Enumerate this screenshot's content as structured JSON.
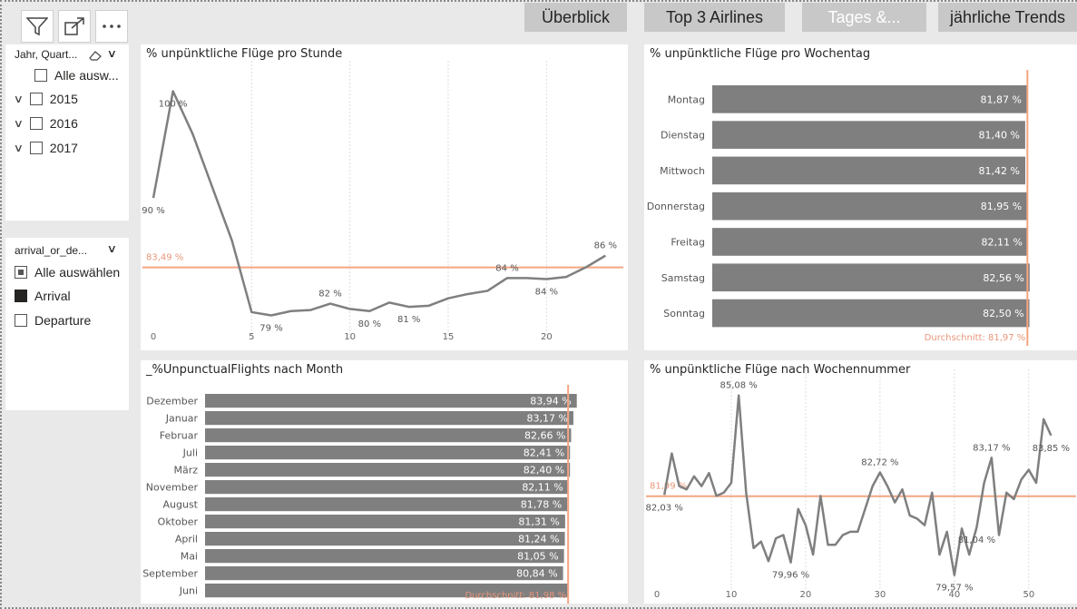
{
  "toolbar": {
    "filter_icon": "filter-icon",
    "expand_icon": "focus-mode-icon",
    "more_icon": "more-options-icon"
  },
  "nav": {
    "overview": "Überblick",
    "top3": "Top 3 Airlines",
    "tages": "Tages &...",
    "trends": "jährliche Trends"
  },
  "slicer_year": {
    "title": "Jahr, Quart...",
    "items": [
      {
        "label": "Alle ausw...",
        "expandable": false
      },
      {
        "label": "2015",
        "expandable": true
      },
      {
        "label": "2016",
        "expandable": true
      },
      {
        "label": "2017",
        "expandable": true
      }
    ]
  },
  "slicer_type": {
    "title": "arrival_or_de...",
    "items": [
      {
        "label": "Alle auswählen",
        "state": "partial"
      },
      {
        "label": "Arrival",
        "state": "checked"
      },
      {
        "label": "Departure",
        "state": "unchecked"
      }
    ]
  },
  "colors": {
    "bar": "#7f7f7f",
    "line": "#7f7f7f",
    "avg": "#f4a582",
    "avg_text": "#e8967a"
  },
  "chart_data": [
    {
      "id": "hour",
      "type": "line",
      "title": "% unpünktliche Flüge pro Stunde",
      "x": [
        0,
        1,
        2,
        3,
        4,
        5,
        6,
        7,
        8,
        9,
        10,
        11,
        12,
        13,
        14,
        15,
        16,
        17,
        18,
        19,
        20,
        21,
        22,
        23
      ],
      "values": [
        90,
        100,
        96,
        91,
        86,
        79.3,
        79,
        79.4,
        79.5,
        80.1,
        79.6,
        79.4,
        80.2,
        79.8,
        79.9,
        80.6,
        81,
        81.3,
        82.5,
        82.5,
        82.4,
        82.6,
        83.5,
        84.6
      ],
      "xticks": [
        0,
        5,
        10,
        15,
        20
      ],
      "xlim": [
        0,
        24
      ],
      "ylim": [
        77,
        102
      ],
      "average": 83.49,
      "average_label": "83,49 %",
      "labels": [
        {
          "i": 0,
          "text": "90 %",
          "pos": "below"
        },
        {
          "i": 1,
          "text": "100 %",
          "pos": "below"
        },
        {
          "i": 6,
          "text": "79 %",
          "pos": "below"
        },
        {
          "i": 9,
          "text": "82 %",
          "pos": "above"
        },
        {
          "i": 11,
          "text": "80 %",
          "pos": "below"
        },
        {
          "i": 13,
          "text": "81 %",
          "pos": "below"
        },
        {
          "i": 18,
          "text": "84 %",
          "pos": "above"
        },
        {
          "i": 20,
          "text": "84 %",
          "pos": "below"
        },
        {
          "i": 23,
          "text": "86 %",
          "pos": "above"
        }
      ]
    },
    {
      "id": "weekday",
      "type": "bar",
      "title": "% unpünktliche Flüge pro Wochentag",
      "categories": [
        "Montag",
        "Dienstag",
        "Mittwoch",
        "Donnerstag",
        "Freitag",
        "Samstag",
        "Sonntag"
      ],
      "values": [
        81.87,
        81.4,
        81.42,
        81.95,
        82.11,
        82.56,
        82.5
      ],
      "value_labels": [
        "81,87 %",
        "81,40 %",
        "81,42 %",
        "81,95 %",
        "82,11 %",
        "82,56 %",
        "82,50 %"
      ],
      "xlim": [
        0,
        82.6
      ],
      "average": 81.97,
      "average_label": "Durchschnitt: 81,97 %"
    },
    {
      "id": "month",
      "type": "bar",
      "title": "_%UnpunctualFlights nach Month",
      "categories": [
        "Dezember",
        "Januar",
        "Februar",
        "Juli",
        "März",
        "November",
        "August",
        "Oktober",
        "April",
        "Mai",
        "September",
        "Juni"
      ],
      "values": [
        83.94,
        83.17,
        82.66,
        82.41,
        82.4,
        82.11,
        81.78,
        81.31,
        81.24,
        81.05,
        80.84,
        82.0
      ],
      "value_labels": [
        "83,94 %",
        "83,17 %",
        "82,66 %",
        "82,41 %",
        "82,40 %",
        "82,11 %",
        "81,78 %",
        "81,31 %",
        "81,24 %",
        "81,05 %",
        "80,84 %",
        ""
      ],
      "xlim": [
        0,
        84
      ],
      "average": 81.98,
      "average_label": "Durchschnitt: 81,98 %"
    },
    {
      "id": "week",
      "type": "line",
      "title": "% unpünktliche Flüge nach Wochennummer",
      "x": [
        1,
        2,
        3,
        4,
        5,
        6,
        7,
        8,
        9,
        10,
        11,
        12,
        13,
        14,
        15,
        16,
        17,
        18,
        19,
        20,
        21,
        22,
        23,
        24,
        25,
        26,
        27,
        28,
        29,
        30,
        31,
        32,
        33,
        34,
        35,
        36,
        37,
        38,
        39,
        40,
        41,
        42,
        43,
        44,
        45,
        46,
        47,
        48,
        49,
        50,
        51,
        52,
        53
      ],
      "values": [
        82.03,
        83.3,
        82.3,
        82.2,
        82.6,
        82.3,
        82.7,
        82.0,
        82.1,
        82.4,
        85.08,
        82.1,
        80.4,
        80.6,
        80.0,
        80.7,
        80.8,
        79.96,
        81.6,
        81.1,
        80.2,
        82.0,
        80.5,
        80.5,
        80.8,
        80.9,
        80.9,
        81.6,
        82.3,
        82.72,
        82.3,
        81.8,
        82.2,
        81.4,
        81.3,
        81.1,
        82.1,
        80.2,
        80.9,
        79.57,
        81.0,
        80.2,
        81.04,
        82.4,
        83.17,
        80.8,
        82.1,
        81.9,
        82.5,
        82.8,
        82.4,
        84.35,
        83.85
      ],
      "xticks": [
        0,
        10,
        20,
        30,
        40,
        50
      ],
      "xlim": [
        0,
        56
      ],
      "ylim": [
        79.2,
        85.6
      ],
      "average": 81.99,
      "average_label": "81,99 %",
      "labels": [
        {
          "i": 0,
          "text": "82,03 %",
          "pos": "below"
        },
        {
          "i": 10,
          "text": "85,08 %",
          "pos": "above"
        },
        {
          "i": 17,
          "text": "79,96 %",
          "pos": "below"
        },
        {
          "i": 29,
          "text": "82,72 %",
          "pos": "above"
        },
        {
          "i": 39,
          "text": "79,57 %",
          "pos": "below"
        },
        {
          "i": 42,
          "text": "81,04 %",
          "pos": "below"
        },
        {
          "i": 44,
          "text": "83,17 %",
          "pos": "above"
        },
        {
          "i": 52,
          "text": "83,85 %",
          "pos": "below"
        }
      ]
    }
  ]
}
